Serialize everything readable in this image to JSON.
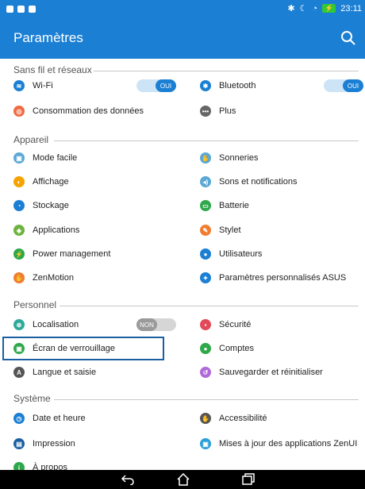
{
  "status": {
    "time": "23:11",
    "battery": "⚡"
  },
  "header": {
    "title": "Paramètres"
  },
  "sections": {
    "wireless": "Sans fil et réseaux",
    "device": "Appareil",
    "personal": "Personnel",
    "system": "Système"
  },
  "items": {
    "wifi": "Wi-Fi",
    "bluetooth": "Bluetooth",
    "data_usage": "Consommation des données",
    "more": "Plus",
    "easy_mode": "Mode facile",
    "sounds": "Sonneries",
    "display": "Affichage",
    "sound_notifs": "Sons et notifications",
    "storage": "Stockage",
    "battery": "Batterie",
    "apps": "Applications",
    "stylus": "Stylet",
    "power_mgmt": "Power management",
    "users": "Utilisateurs",
    "zenmotion": "ZenMotion",
    "asus_settings": "Paramètres personnalisés ASUS",
    "location": "Localisation",
    "security": "Sécurité",
    "lockscreen": "Écran de verrouillage",
    "accounts": "Comptes",
    "language": "Langue et saisie",
    "backup": "Sauvegarder et réinitialiser",
    "datetime": "Date et heure",
    "accessibility": "Accessibilité",
    "printing": "Impression",
    "zenui_updates": "Mises à jour des applications ZenUI",
    "about": "À propos"
  },
  "toggles": {
    "wifi": "OUI",
    "bluetooth": "OUI",
    "location": "NON"
  },
  "icon_letters": {
    "language": "A",
    "about": "i"
  }
}
